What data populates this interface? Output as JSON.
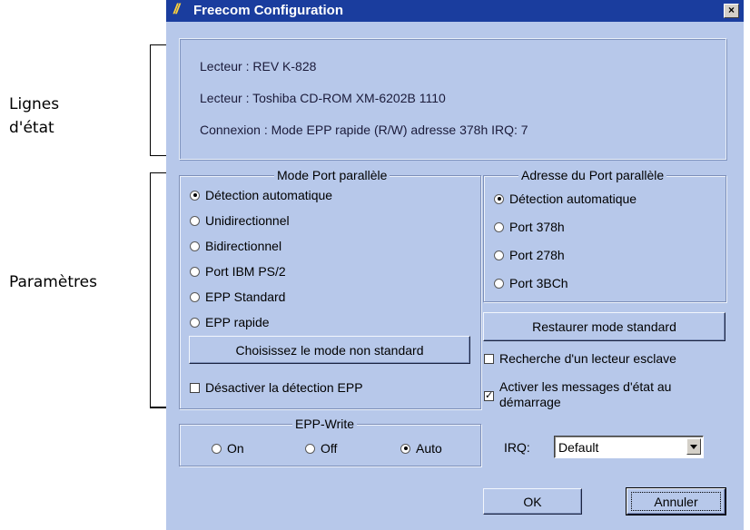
{
  "annotations": {
    "status_label_line1": "Lignes",
    "status_label_line2": "d'état",
    "params_label": "Paramètres"
  },
  "window": {
    "logo": "//",
    "title": "Freecom Configuration",
    "close": "×"
  },
  "status": {
    "line1": "Lecteur :  REV K-828",
    "line2": "Lecteur : Toshiba CD-ROM XM-6202B 1110",
    "line3": "Connexion : Mode EPP rapide (R/W)  adresse 378h IRQ: 7"
  },
  "mode_group": {
    "legend": "Mode Port parallèle",
    "options": [
      {
        "label": "Détection automatique",
        "checked": true
      },
      {
        "label": "Unidirectionnel",
        "checked": false
      },
      {
        "label": "Bidirectionnel",
        "checked": false
      },
      {
        "label": "Port IBM PS/2",
        "checked": false
      },
      {
        "label": "EPP Standard",
        "checked": false
      },
      {
        "label": "EPP rapide",
        "checked": false
      }
    ],
    "nonstandard_button": "Choisissez le mode non standard",
    "disable_epp": {
      "label": "Désactiver la détection EPP",
      "checked": false
    }
  },
  "address_group": {
    "legend": "Adresse du Port parallèle",
    "options": [
      {
        "label": "Détection automatique",
        "checked": true
      },
      {
        "label": "Port 378h",
        "checked": false
      },
      {
        "label": "Port 278h",
        "checked": false
      },
      {
        "label": "Port 3BCh",
        "checked": false
      }
    ]
  },
  "restore_button": "Restaurer mode standard",
  "slave_search": {
    "label": "Recherche d'un lecteur esclave",
    "checked": false
  },
  "status_messages": {
    "label_line1": "Activer les messages d'état au",
    "label_line2": "démarrage",
    "checked": true,
    "check_glyph": "✓"
  },
  "epp_write": {
    "legend": "EPP-Write",
    "options": [
      {
        "label": "On",
        "checked": false
      },
      {
        "label": "Off",
        "checked": false
      },
      {
        "label": "Auto",
        "checked": true
      }
    ]
  },
  "irq": {
    "label": "IRQ:",
    "value": "Default"
  },
  "buttons": {
    "ok": "OK",
    "cancel": "Annuler"
  }
}
